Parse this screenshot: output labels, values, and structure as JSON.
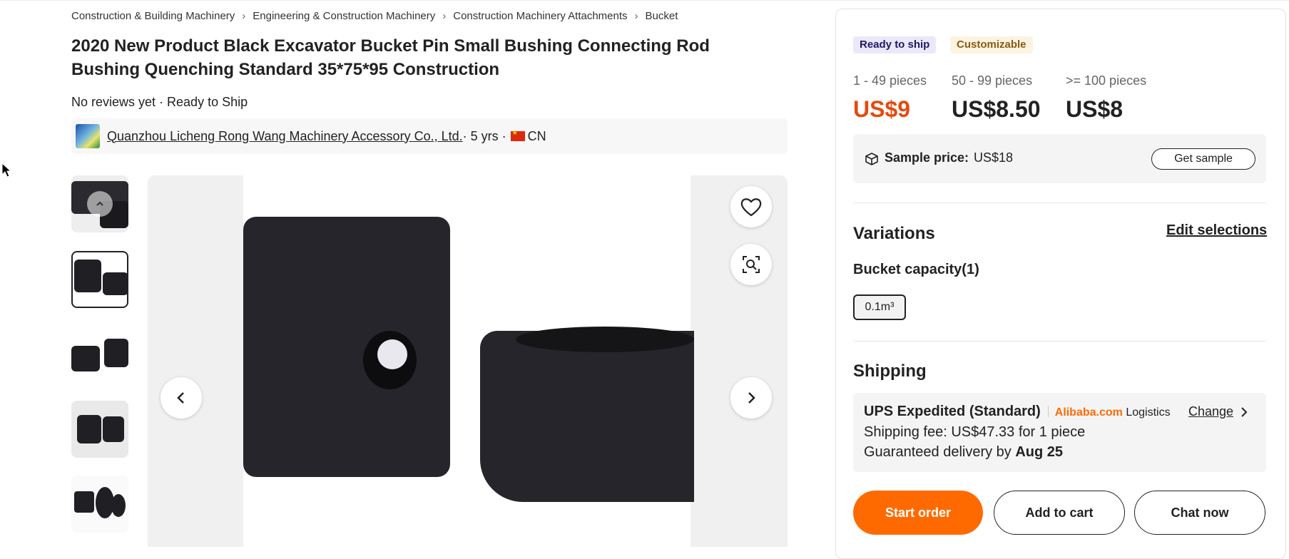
{
  "breadcrumb": [
    "Construction & Building Machinery",
    "Engineering & Construction Machinery",
    "Construction Machinery Attachments",
    "Bucket"
  ],
  "product": {
    "title": "2020 New Product Black Excavator Bucket Pin Small Bushing Connecting Rod Bushing Quenching Standard 35*75*95 Construction",
    "meta": "No reviews yet · Ready to Ship"
  },
  "supplier": {
    "name": "Quanzhou Licheng Rong Wang Machinery Accessory Co., Ltd.",
    "years": " · 5 yrs · ",
    "country": "CN"
  },
  "gallery": {
    "thumbnail_count": 5,
    "selected_index": 1,
    "icons": [
      "heart-icon",
      "image-search-icon",
      "chevron-left-icon",
      "chevron-right-icon",
      "play-icon"
    ]
  },
  "tags": {
    "ready": "Ready to ship",
    "custom": "Customizable"
  },
  "pricing": [
    {
      "qty": "1 - 49 pieces",
      "price": "US$9"
    },
    {
      "qty": "50 - 99 pieces",
      "price": "US$8.50"
    },
    {
      "qty": ">= 100 pieces",
      "price": "US$8"
    }
  ],
  "sample": {
    "label": "Sample price:",
    "price": "US$18",
    "button": "Get sample",
    "icon": "box-icon"
  },
  "variations": {
    "heading": "Variations",
    "edit": "Edit selections",
    "group": "Bucket capacity(1)",
    "option": "0.1m³"
  },
  "shipping": {
    "heading": "Shipping",
    "method": "UPS Expedited (Standard)",
    "brand": "Alibaba.com",
    "logistics": "Logistics",
    "change": "Change",
    "fee": "Shipping fee: US$47.33 for 1 piece",
    "delivery_prefix": "Guaranteed delivery by ",
    "delivery_date": "Aug 25"
  },
  "actions": {
    "start": "Start order",
    "cart": "Add to cart",
    "chat": "Chat now"
  },
  "colors": {
    "accent": "#ff6a00",
    "price_highlight": "#e64a0d",
    "ready_bg": "#ece8fb",
    "custom_bg": "#fdf3e1"
  }
}
